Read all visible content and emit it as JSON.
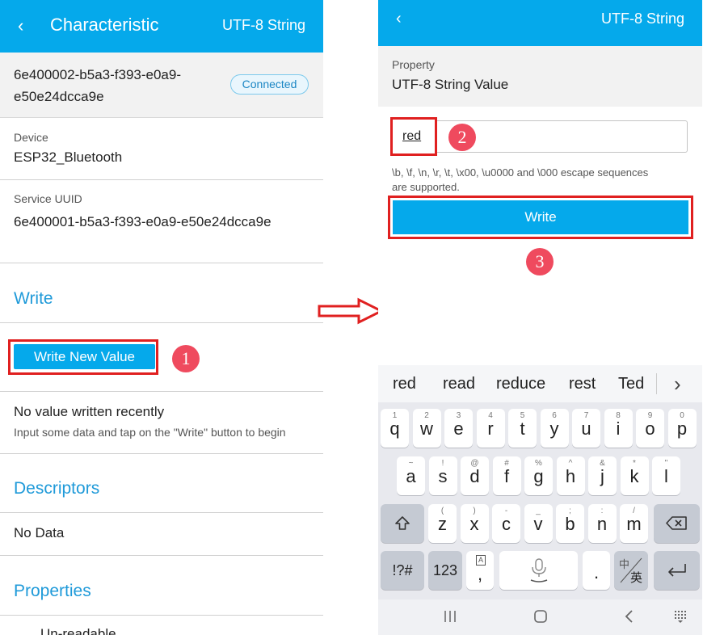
{
  "left": {
    "header": {
      "back_icon": "‹",
      "title": "Characteristic",
      "right_label": "UTF-8 String"
    },
    "uuid": "6e400002-b5a3-f393-e0a9-e50e24dcca9e",
    "status_pill": "Connected",
    "device_label": "Device",
    "device_value": "ESP32_Bluetooth",
    "service_label": "Service UUID",
    "service_value": "6e400001-b5a3-f393-e0a9-e50e24dcca9e",
    "write_heading": "Write",
    "write_new_value": "Write New Value",
    "step1": "1",
    "no_value_title": "No value written recently",
    "no_value_hint": "Input some data and tap on the \"Write\" button to begin",
    "descriptors_heading": "Descriptors",
    "no_data": "No Data",
    "properties_heading": "Properties",
    "partial_property": "Un-readable"
  },
  "right": {
    "header": {
      "back_icon": "‹",
      "right_label": "UTF-8 String"
    },
    "property_label": "Property",
    "property_value": "UTF-8 String Value",
    "input_value": "red",
    "step2": "2",
    "hint": "\\b, \\f, \\n, \\r, \\t, \\x00, \\u0000 and \\000 escape sequences are supported.",
    "write_button": "Write",
    "step3": "3",
    "keyboard": {
      "suggestions": [
        "red",
        "read",
        "reduce",
        "rest",
        "Ted"
      ],
      "more_icon": "›",
      "row1": [
        [
          "q",
          "1"
        ],
        [
          "w",
          "2"
        ],
        [
          "e",
          "3"
        ],
        [
          "r",
          "4"
        ],
        [
          "t",
          "5"
        ],
        [
          "y",
          "6"
        ],
        [
          "u",
          "7"
        ],
        [
          "i",
          "8"
        ],
        [
          "o",
          "9"
        ],
        [
          "p",
          "0"
        ]
      ],
      "row2": [
        [
          "a",
          "~"
        ],
        [
          "s",
          "!"
        ],
        [
          "d",
          "@"
        ],
        [
          "f",
          "#"
        ],
        [
          "g",
          "%"
        ],
        [
          "h",
          "^"
        ],
        [
          "j",
          "&"
        ],
        [
          "k",
          "*"
        ],
        [
          "l",
          "\""
        ]
      ],
      "row3": [
        [
          "z",
          "("
        ],
        [
          "x",
          ")"
        ],
        [
          "c",
          "-"
        ],
        [
          "v",
          "_"
        ],
        [
          "b",
          ";"
        ],
        [
          "n",
          ":"
        ],
        [
          "m",
          "/"
        ]
      ],
      "sym_key": "!?#",
      "num_key": "123",
      "comma_sub": "A",
      "comma_key": ",",
      "period_key": ".",
      "lang_top": "中",
      "lang_bottom": "英"
    }
  }
}
